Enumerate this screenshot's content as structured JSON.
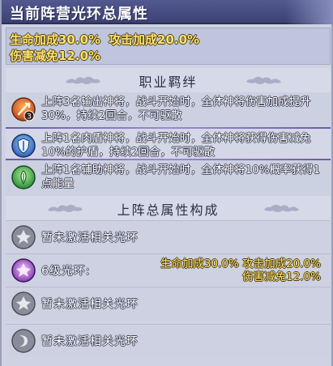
{
  "window": {
    "title": "当前阵营光环总属性"
  },
  "summary": {
    "hp_bonus": "生命加成30.0%",
    "atk_bonus": "攻击加成20.0%",
    "dmg_reduction": "伤害减免12.0%"
  },
  "bonds_section": {
    "title": "职业羁绊",
    "items": [
      {
        "icon": "sword-icon",
        "badge": "3",
        "text": "上阵3名输出神将，战斗开始时，全体神将伤害加成提升30%，持续2回合，不可驱散"
      },
      {
        "icon": "shield-icon",
        "badge": "",
        "text": "上阵1名肉盾神将，战斗开始时，全体神将获得伤害减免10%的护盾，持续2回合，不可驱散"
      },
      {
        "icon": "leaf-icon",
        "badge": "",
        "text": "上阵1名辅助神将，战斗开始时，全体神将10%概率获得1点能量"
      }
    ]
  },
  "attributes_section": {
    "title": "上阵总属性构成",
    "items": [
      {
        "icon": "aura-gray-icon",
        "label": "暂未激活相关光环"
      },
      {
        "icon": "aura-purple-icon",
        "label": "6级光环:",
        "stat_line1": "生命加成30.0% 攻击加成20.0%",
        "stat_line2": "伤害减免12.0%"
      },
      {
        "icon": "aura-gray-icon",
        "label": "暂未激活相关光环"
      },
      {
        "icon": "aura-gray-icon",
        "label": "暂未激活相关光环"
      }
    ]
  },
  "colors": {
    "title_bar": "#464c82",
    "stat_text": "#ffe36a",
    "divider": "#8a78c4",
    "panel_bg": "#ced2e2"
  }
}
